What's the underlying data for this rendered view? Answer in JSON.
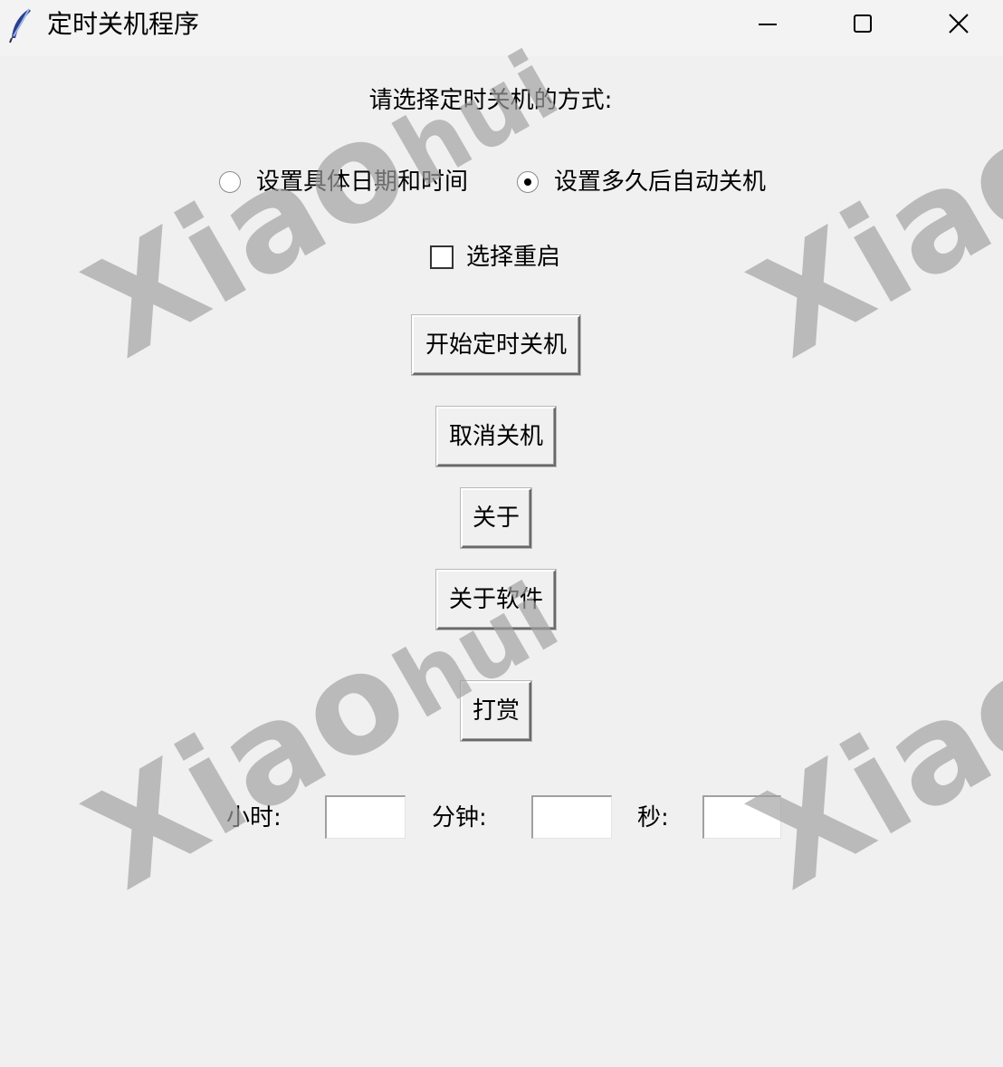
{
  "window": {
    "title": "定时关机程序"
  },
  "main": {
    "prompt": "请选择定时关机的方式:",
    "radio_options": [
      {
        "label": "设置具体日期和时间",
        "selected": false
      },
      {
        "label": "设置多久后自动关机",
        "selected": true
      }
    ],
    "reboot_checkbox": {
      "label": "选择重启",
      "checked": false
    },
    "buttons": {
      "start": "开始定时关机",
      "cancel": "取消关机",
      "about": "关于",
      "about_software": "关于软件",
      "reward": "打赏"
    },
    "time_fields": {
      "hours_label": "小时:",
      "hours_value": "",
      "minutes_label": "分钟:",
      "minutes_value": "",
      "seconds_label": "秒:",
      "seconds_value": ""
    }
  },
  "watermark": {
    "big": "Xiao",
    "small": "hui"
  },
  "icons": {
    "app": "feather-icon",
    "minimize": "minimize-icon",
    "maximize": "maximize-icon",
    "close": "close-icon"
  }
}
